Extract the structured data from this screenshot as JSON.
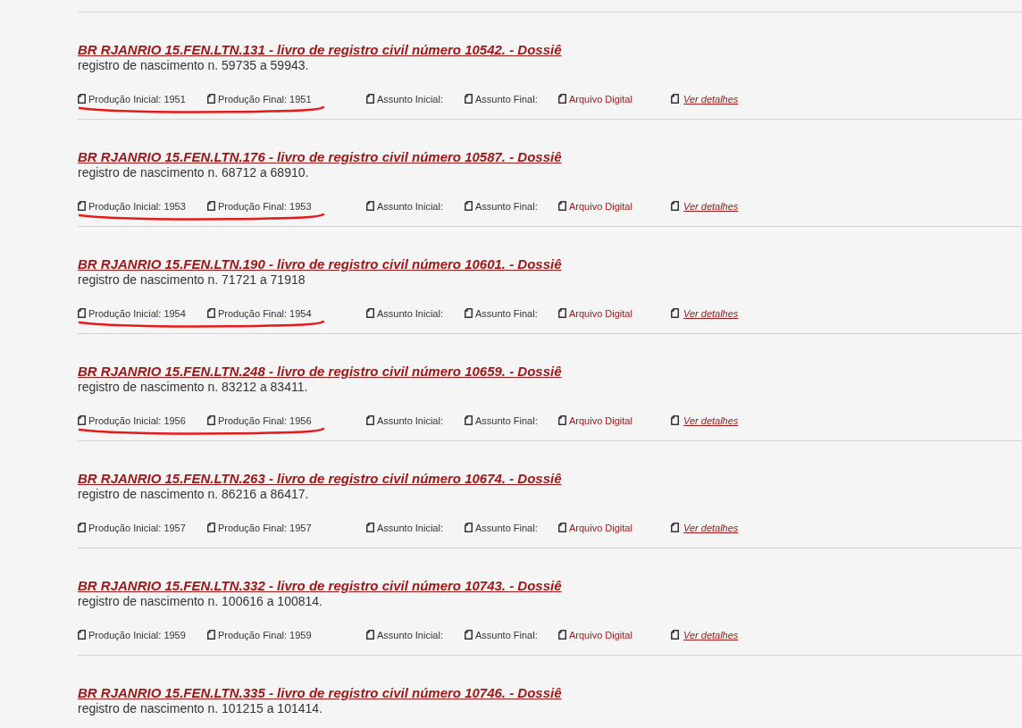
{
  "records": [
    {
      "title": "BR RJANRIO 15.FEN.LTN.131 - livro de registro civil número 10542. - Dossiê",
      "description": "registro de nascimento n. 59735 a 59943.",
      "annotated": true,
      "meta": [
        {
          "kind": "text",
          "label": "Produção Inicial: 1951"
        },
        {
          "kind": "text",
          "label": "Produção Final: 1951"
        },
        {
          "kind": "text",
          "label": "Assunto Inicial:"
        },
        {
          "kind": "text",
          "label": "Assunto Final:"
        },
        {
          "kind": "digital",
          "label": "Arquivo Digital"
        },
        {
          "kind": "link",
          "label": "Ver detalhes"
        }
      ]
    },
    {
      "title": "BR RJANRIO 15.FEN.LTN.176 - livro de registro civil número 10587. - Dossiê",
      "description": "registro de nascimento n. 68712 a 68910.",
      "annotated": true,
      "meta": [
        {
          "kind": "text",
          "label": "Produção Inicial: 1953"
        },
        {
          "kind": "text",
          "label": "Produção Final: 1953"
        },
        {
          "kind": "text",
          "label": "Assunto Inicial:"
        },
        {
          "kind": "text",
          "label": "Assunto Final:"
        },
        {
          "kind": "digital",
          "label": "Arquivo Digital"
        },
        {
          "kind": "link",
          "label": "Ver detalhes"
        }
      ]
    },
    {
      "title": "BR RJANRIO 15.FEN.LTN.190 - livro de registro civil número 10601. - Dossiê",
      "description": "registro de nascimento n. 71721 a 71918",
      "annotated": true,
      "meta": [
        {
          "kind": "text",
          "label": "Produção Inicial: 1954"
        },
        {
          "kind": "text",
          "label": "Produção Final: 1954"
        },
        {
          "kind": "text",
          "label": "Assunto Inicial:"
        },
        {
          "kind": "text",
          "label": "Assunto Final:"
        },
        {
          "kind": "digital",
          "label": "Arquivo Digital"
        },
        {
          "kind": "link",
          "label": "Ver detalhes"
        }
      ]
    },
    {
      "title": "BR RJANRIO 15.FEN.LTN.248 - livro de registro civil número 10659. - Dossiê",
      "description": "registro de nascimento n. 83212 a 83411.",
      "annotated": true,
      "meta": [
        {
          "kind": "text",
          "label": "Produção Inicial: 1956"
        },
        {
          "kind": "text",
          "label": "Produção Final: 1956"
        },
        {
          "kind": "text",
          "label": "Assunto Inicial:"
        },
        {
          "kind": "text",
          "label": "Assunto Final:"
        },
        {
          "kind": "digital",
          "label": "Arquivo Digital"
        },
        {
          "kind": "link",
          "label": "Ver detalhes"
        }
      ]
    },
    {
      "title": "BR RJANRIO 15.FEN.LTN.263 - livro de registro civil número 10674. - Dossiê",
      "description": "registro de nascimento n. 86216 a 86417.",
      "annotated": false,
      "meta": [
        {
          "kind": "text",
          "label": "Produção Inicial: 1957"
        },
        {
          "kind": "text",
          "label": "Produção Final: 1957"
        },
        {
          "kind": "text",
          "label": "Assunto Inicial:"
        },
        {
          "kind": "text",
          "label": "Assunto Final:"
        },
        {
          "kind": "digital",
          "label": "Arquivo Digital"
        },
        {
          "kind": "link",
          "label": "Ver detalhes"
        }
      ]
    },
    {
      "title": "BR RJANRIO 15.FEN.LTN.332 - livro de registro civil número 10743. - Dossiê",
      "description": "registro de nascimento n. 100616 a 100814.",
      "annotated": false,
      "meta": [
        {
          "kind": "text",
          "label": "Produção Inicial: 1959"
        },
        {
          "kind": "text",
          "label": "Produção Final: 1959"
        },
        {
          "kind": "text",
          "label": "Assunto Inicial:"
        },
        {
          "kind": "text",
          "label": "Assunto Final:"
        },
        {
          "kind": "digital",
          "label": "Arquivo Digital"
        },
        {
          "kind": "link",
          "label": "Ver detalhes"
        }
      ]
    },
    {
      "title": "BR RJANRIO 15.FEN.LTN.335 - livro de registro civil número 10746. - Dossiê",
      "description": "registro de nascimento n. 101215 a 101414."
    }
  ]
}
